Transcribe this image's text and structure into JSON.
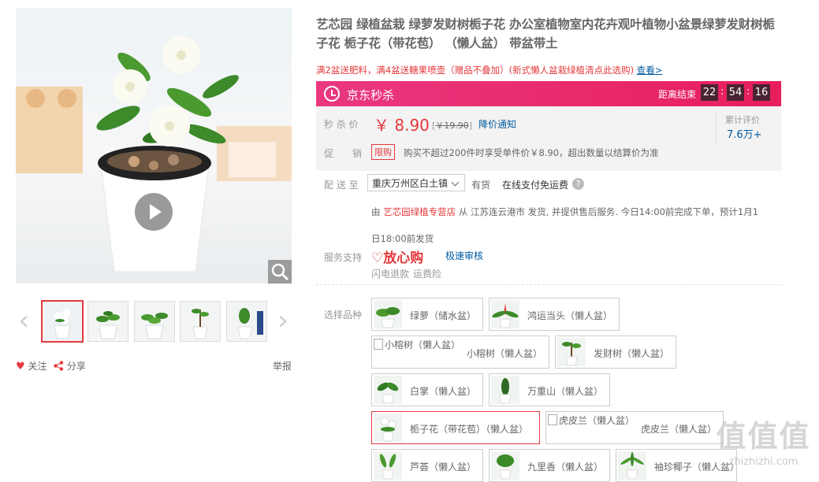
{
  "product": {
    "title": "艺芯园 绿植盆栽 绿萝发财树栀子花 办公室植物室内花卉观叶植物小盆景绿萝发财树栀子花 栀子花（带花苞） （懒人盆） 带盆带土",
    "promo_text": "满2盆送肥料，满4盆送糖果喷壶（赠品不叠加）(新式懒人盆栽绿植清点此选购)",
    "promo_link": "查看>"
  },
  "miaosha": {
    "title": "京东秒杀",
    "end_label": "距离结束",
    "countdown": [
      "22",
      "54",
      "16"
    ],
    "sep": ":"
  },
  "price": {
    "label": "秒 杀 价",
    "value": "￥ 8.90",
    "old_open": "[",
    "old_price": "￥19.90",
    "old_close": "]",
    "notify": "降价通知",
    "comment_label": "累计评价",
    "comment_count": "7.6万+"
  },
  "promotion": {
    "label": "促　　销",
    "tag": "限购",
    "text": "购买不超过200件时享受单件价￥8.90，超出数量以结算价为准"
  },
  "delivery": {
    "label": "配 送 至",
    "destination": "重庆万州区白土镇",
    "stock": "有货",
    "payment": "在线支付免运费",
    "help": "?",
    "from_word": "由",
    "shop": "艺芯园绿植专营店",
    "ship_line1": "从 江苏连云港市 发货, 并提供售后服务. 今日14:00前完成下单，预计1月1",
    "ship_line2": "日18:00前发货"
  },
  "service": {
    "label": "服务支持",
    "fangxin": "放心购",
    "fast_review": "极速审核",
    "refund": "闪电退款",
    "freight": "运费险"
  },
  "variants": {
    "label": "选择品种",
    "items": [
      {
        "text": "绿萝（储水盆）"
      },
      {
        "text": "鸿运当头（懒人盆）"
      },
      {
        "alt": "小榕树（懒人盆）",
        "text": "小榕树（懒人盆）"
      },
      {
        "text": "发财树（懒人盆）"
      },
      {
        "text": "白掌（懒人盆）"
      },
      {
        "text": "万重山（懒人盆）"
      },
      {
        "text": "栀子花（带花苞）（懒人盆）"
      },
      {
        "alt": "虎皮兰（懒人盆）",
        "text": "虎皮兰（懒人盆）"
      },
      {
        "text": "芦荟（懒人盆）"
      },
      {
        "text": "九里香（懒人盆）"
      },
      {
        "text": "袖珍椰子（懒人盆）"
      }
    ]
  },
  "gallery": {
    "follow": "关注",
    "share": "分享",
    "report": "举报",
    "prev": "‹",
    "next": "›"
  },
  "watermark": {
    "text": "值值值",
    "sub": "zhizhizhi.com"
  }
}
